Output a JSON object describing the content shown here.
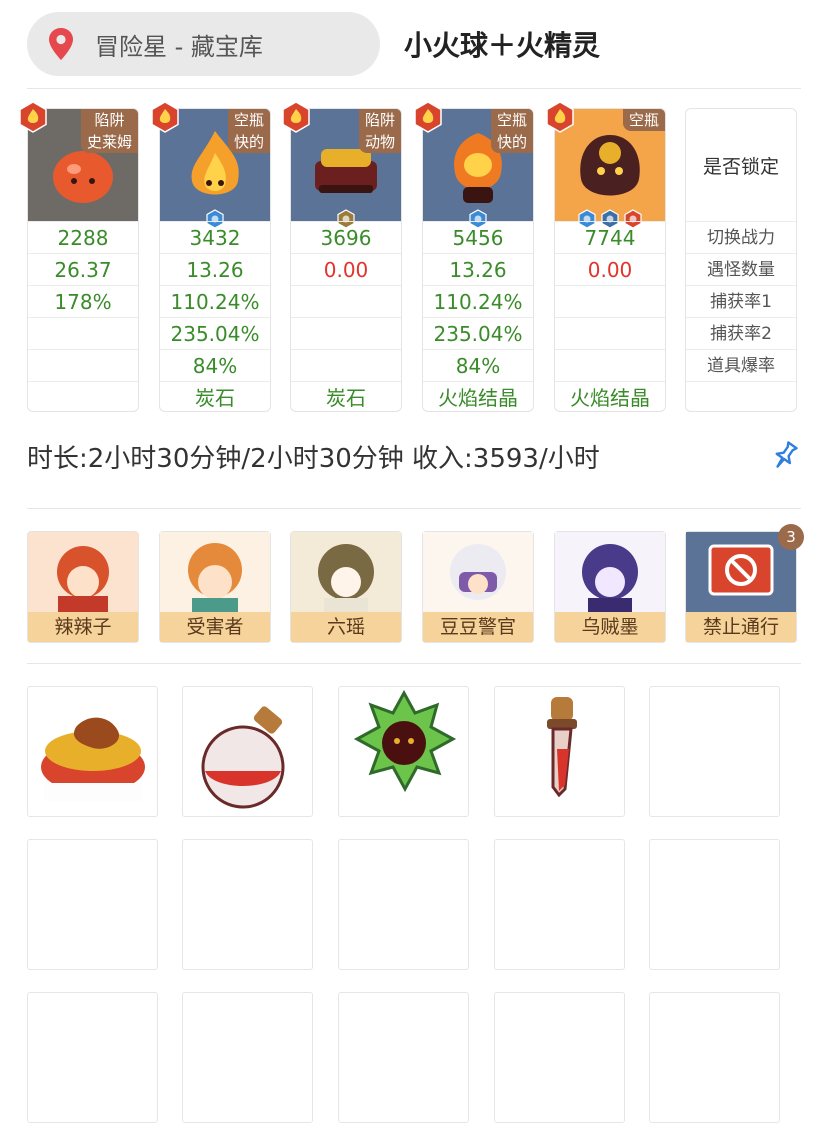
{
  "header": {
    "location": "冒险星 - 藏宝库",
    "team_title": "小火球＋火精灵"
  },
  "monsters": [
    {
      "tag": "陷阱\n史莱姆",
      "stats": [
        "2288",
        "26.37",
        "178%",
        "",
        "",
        ""
      ],
      "color": "#e85a2e"
    },
    {
      "tag": "空瓶\n快的",
      "stats": [
        "3432",
        "13.26",
        "110.24%",
        "235.04%",
        "84%",
        "炭石"
      ],
      "color": "#f5a02a"
    },
    {
      "tag": "陷阱\n动物",
      "stats": [
        "3696",
        "0.00",
        "",
        "",
        "",
        "炭石"
      ],
      "color": "#6b1f1f"
    },
    {
      "tag": "空瓶\n快的",
      "stats": [
        "5456",
        "13.26",
        "110.24%",
        "235.04%",
        "84%",
        "火焰结晶"
      ],
      "color": "#f07a22"
    },
    {
      "tag": "空瓶",
      "stats": [
        "7744",
        "0.00",
        "",
        "",
        "",
        "火焰结晶"
      ],
      "color": "#4a2020"
    }
  ],
  "row_labels": {
    "lock": "是否锁定",
    "rows": [
      "切换战力",
      "遇怪数量",
      "捕获率1",
      "捕获率2",
      "道具爆率"
    ]
  },
  "summary": {
    "text": "时长:2小时30分钟/2小时30分钟 收入:3593/小时"
  },
  "npcs": [
    {
      "name": "辣辣子"
    },
    {
      "name": "受害者"
    },
    {
      "name": "六瑶"
    },
    {
      "name": "豆豆警官"
    },
    {
      "name": "乌贼墨"
    },
    {
      "name": "禁止通行",
      "count": "3"
    }
  ],
  "colors": {
    "accent_brown": "#9b6a4a",
    "stat_green": "#3a8b2a",
    "stat_red": "#e0342b",
    "portrait_blue": "#5b7396",
    "portrait_gray": "#6e6a66",
    "portrait_orange": "#f4a54a",
    "pin_blue": "#2f7fe0",
    "location_red": "#e5484d"
  },
  "items": [
    {
      "icon": "fried-chicken-bowl-icon"
    },
    {
      "icon": "red-potion-flask-icon"
    },
    {
      "icon": "green-flower-orb-icon"
    },
    {
      "icon": "red-dropper-icon"
    }
  ]
}
